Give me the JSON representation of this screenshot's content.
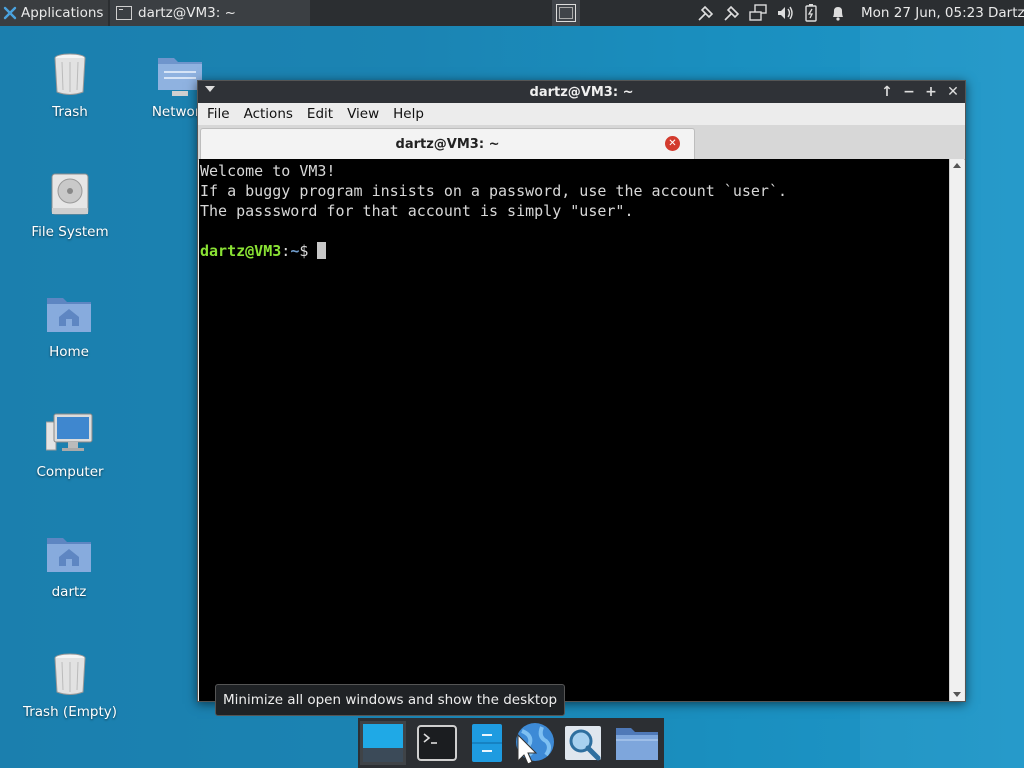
{
  "top_panel": {
    "applications_label": "Applications",
    "task_terminal_label": "dartz@VM3: ~",
    "clock": "Mon 27 Jun, 05:23",
    "user": "Dartz"
  },
  "desktop_icons": {
    "trash": "Trash",
    "network": "Network",
    "file_system": "File System",
    "home": "Home",
    "computer": "Computer",
    "dartz": "dartz",
    "trash_empty": "Trash (Empty)"
  },
  "terminal_window": {
    "title": "dartz@VM3: ~",
    "menu": [
      "File",
      "Actions",
      "Edit",
      "View",
      "Help"
    ],
    "tab_title": "dartz@VM3: ~",
    "lines": [
      "Welcome to VM3!",
      "If a buggy program insists on a password, use the account `user`.",
      "The passsword for that account is simply \"user\"."
    ],
    "prompt_user": "dartz@VM3",
    "prompt_colon": ":",
    "prompt_path": "~",
    "prompt_symbol": "$ "
  },
  "tooltip": "Minimize all open windows and show the desktop",
  "icons": {
    "top_panel": [
      "xfce-mouse-icon",
      "terminal-icon",
      "show-desktop-icon",
      "network-disconnected-icon",
      "network-disconnected-icon",
      "network-wired-icon",
      "volume-icon",
      "battery-icon",
      "notification-bell-icon"
    ],
    "dock": [
      "show-desktop-icon",
      "terminal-icon",
      "file-manager-icon",
      "web-browser-icon",
      "app-finder-icon",
      "folder-icon"
    ]
  },
  "colors": {
    "prompt_user": "#8ae234",
    "prompt_path": "#729fcf",
    "desktop": "#1b84b3",
    "panel": "#2b2e31"
  }
}
